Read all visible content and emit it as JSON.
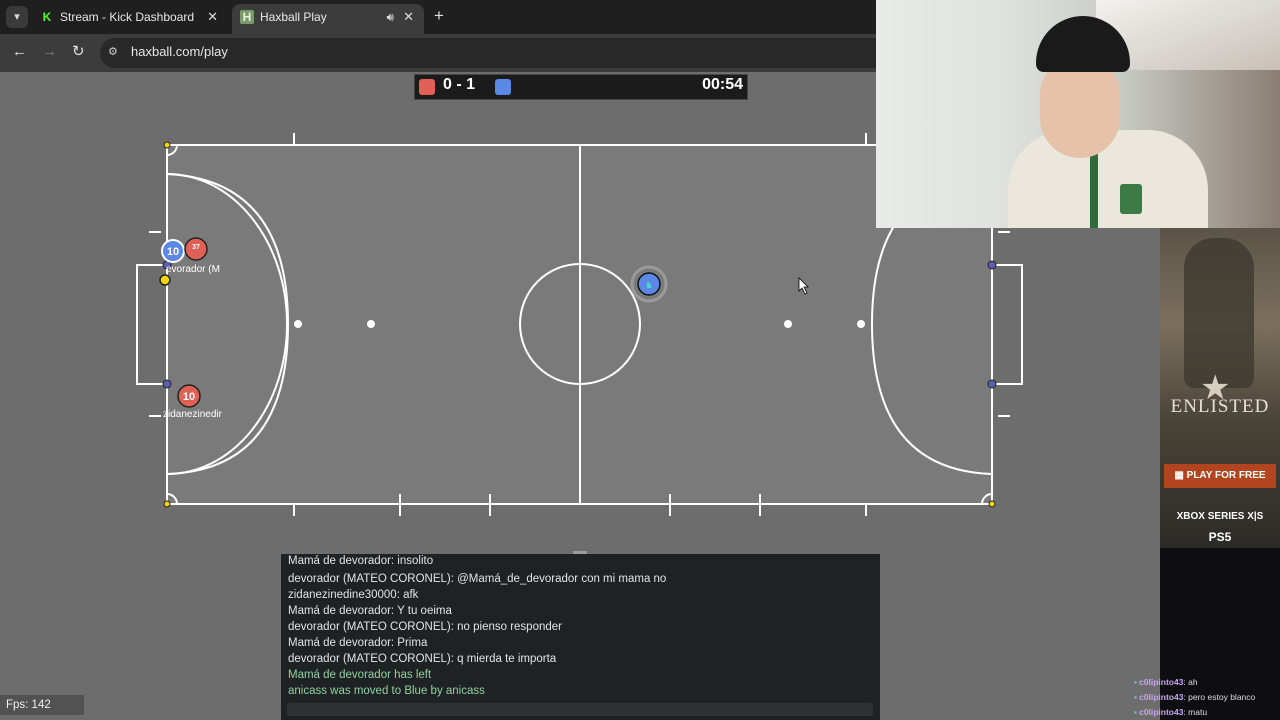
{
  "browser": {
    "tabs": [
      {
        "label": "Stream - Kick Dashboard",
        "icon": "kick-icon"
      },
      {
        "label": "Haxball Play",
        "icon": "haxball-icon"
      }
    ],
    "url": "haxball.com/play"
  },
  "scoreboard": {
    "score": "0 - 1",
    "time": "00:54",
    "red_color": "#e06055",
    "blue_color": "#5b88e6"
  },
  "players": [
    {
      "number": "10",
      "team": "blue"
    },
    {
      "number": "37",
      "team": "red"
    },
    {
      "number": "10",
      "team": "red"
    }
  ],
  "player_labels": [
    "evorador (M",
    "zidanezinedir"
  ],
  "chat": {
    "messages": [
      {
        "text": "Mamá de devorador: insolito",
        "type": "msg"
      },
      {
        "text": "devorador (MATEO CORONEL): @Mamá_de_devorador con mi mama no",
        "type": "msg"
      },
      {
        "text": "zidanezinedine30000: afk",
        "type": "msg"
      },
      {
        "text": "Mamá de devorador: Y tu oeima",
        "type": "msg"
      },
      {
        "text": "devorador (MATEO CORONEL): no pienso responder",
        "type": "msg"
      },
      {
        "text": "Mamá de devorador: Prima",
        "type": "msg"
      },
      {
        "text": "devorador (MATEO CORONEL): q mierda te importa",
        "type": "msg"
      },
      {
        "text": "Mamá de devorador has left",
        "type": "sys"
      },
      {
        "text": "anicass was moved to Blue by anicass",
        "type": "sys"
      }
    ]
  },
  "fps": "Fps: 142",
  "ad": {
    "title": "ENLISTED",
    "cta": "PLAY FOR FREE",
    "platform1": "XBOX SERIES X|S",
    "platform2": "PS5"
  },
  "stream_chat": [
    {
      "user": "c0lipinto43",
      "text": ": ah"
    },
    {
      "user": "c0lipinto43",
      "text": ": pero estoy blanco"
    },
    {
      "user": "c0lipinto43",
      "text": ": matu"
    }
  ]
}
